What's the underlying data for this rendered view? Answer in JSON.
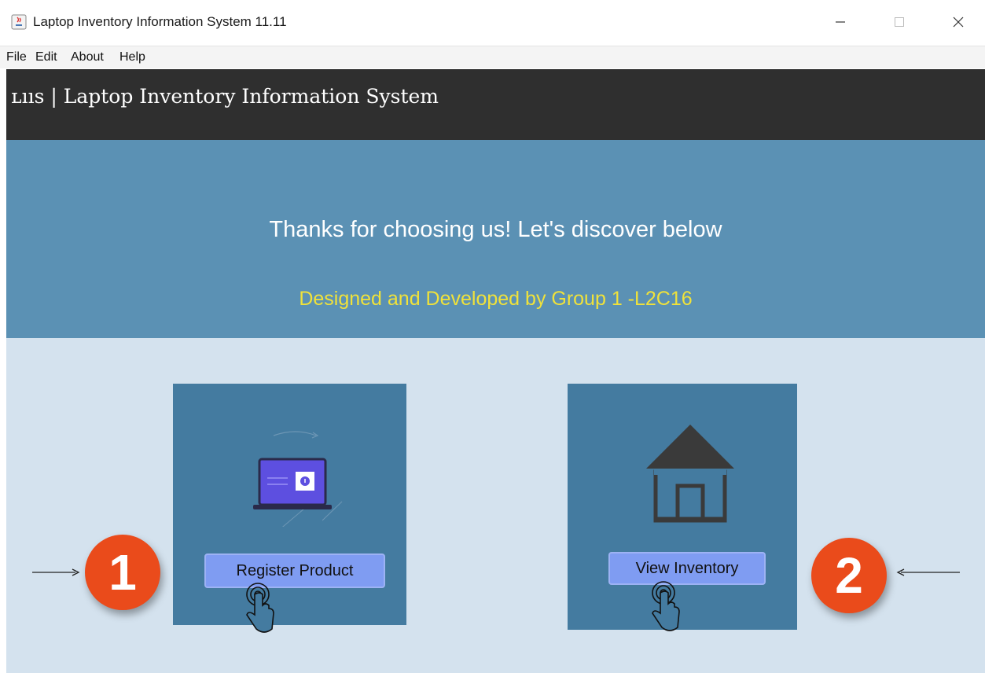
{
  "window": {
    "title": "Laptop Inventory Information System 11.11",
    "icons": [
      "java-app-icon",
      "minimize-icon",
      "maximize-icon",
      "close-icon"
    ]
  },
  "menu": {
    "items": [
      "File",
      "Edit",
      "About",
      "Help"
    ]
  },
  "header": {
    "title": "ʟııs | Laptop Inventory Information System"
  },
  "banner": {
    "main_text": "Thanks for choosing us! Let's discover below",
    "sub_text": "Designed and Developed by Group 1 -L2C16"
  },
  "cards": {
    "register": {
      "button_label": "Register Product",
      "icon": "laptop-upload-icon"
    },
    "inventory": {
      "button_label": "View Inventory",
      "icon": "house-icon"
    }
  },
  "badges": {
    "first": "1",
    "second": "2"
  },
  "colors": {
    "header_bg": "#2f2f2f",
    "banner_bg": "#5b91b4",
    "content_bg": "#d4e2ee",
    "card_bg": "#447ba0",
    "button_bg": "#7f9cf2",
    "subtitle_yellow": "#f0e23a",
    "badge_orange": "#ea4b1b"
  }
}
